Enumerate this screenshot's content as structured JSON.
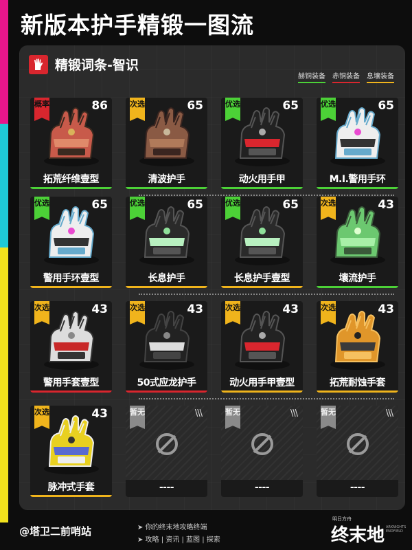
{
  "title": "新版本护手精锻一图流",
  "header": {
    "title": "精锻词条-智识",
    "icon": "glove-icon"
  },
  "legend": [
    {
      "label": "赫铜装备",
      "color": "#4cd137"
    },
    {
      "label": "赤铜装备",
      "color": "#d9262e"
    },
    {
      "label": "息壤装备",
      "color": "#f0b41c"
    }
  ],
  "colors": {
    "badge_red": "#d9262e",
    "badge_gold": "#f0b41c",
    "badge_green": "#4cd137",
    "badge_gray": "#8a8a8a"
  },
  "rows": [
    [
      {
        "name": "拓荒纤维壹型",
        "badge": "概率",
        "badge_type": "red",
        "level": "86",
        "tier": "green",
        "item": "red-glove-icon"
      },
      {
        "name": "清波护手",
        "badge": "次选",
        "badge_type": "gold",
        "level": "65",
        "tier": "green",
        "item": "brown-glove-icon"
      },
      {
        "name": "动火用手甲",
        "badge": "优选",
        "badge_type": "green",
        "level": "65",
        "tier": "green",
        "item": "red-armor-glove-icon"
      },
      {
        "name": "M.I.警用手环",
        "badge": "优选",
        "badge_type": "green",
        "level": "65",
        "tier": "green",
        "item": "white-glove-icon"
      }
    ],
    [
      {
        "name": "警用手环壹型",
        "badge": "优选",
        "badge_type": "green",
        "level": "65",
        "tier": "gold",
        "item": "white-glove-icon"
      },
      {
        "name": "长息护手",
        "badge": "优选",
        "badge_type": "green",
        "level": "65",
        "tier": "gold",
        "item": "green-glove-icon"
      },
      {
        "name": "长息护手壹型",
        "badge": "优选",
        "badge_type": "green",
        "level": "65",
        "tier": "gold",
        "item": "green-glove-icon"
      },
      {
        "name": "壤流护手",
        "badge": "次选",
        "badge_type": "gold",
        "level": "43",
        "tier": "green",
        "item": "crystal-glove-icon"
      }
    ],
    [
      {
        "name": "警用手套壹型",
        "badge": "次选",
        "badge_type": "gold",
        "level": "43",
        "tier": "red",
        "item": "red-white-glove-icon"
      },
      {
        "name": "50式应龙护手",
        "badge": "次选",
        "badge_type": "gold",
        "level": "43",
        "tier": "red",
        "item": "black-glove-icon"
      },
      {
        "name": "动火用手甲壹型",
        "badge": "次选",
        "badge_type": "gold",
        "level": "43",
        "tier": "gold",
        "item": "red-armor-glove-icon"
      },
      {
        "name": "拓荒耐蚀手套",
        "badge": "次选",
        "badge_type": "gold",
        "level": "43",
        "tier": "gold",
        "item": "orange-glove-icon"
      }
    ],
    [
      {
        "name": "脉冲式手套",
        "badge": "次选",
        "badge_type": "gold",
        "level": "43",
        "tier": "gold",
        "item": "yellow-glove-icon"
      },
      {
        "name": "----",
        "badge": "暂无",
        "badge_type": "gray",
        "level": "",
        "slashes": "\\\\\\",
        "tier": "none",
        "item": "empty-slot-icon"
      },
      {
        "name": "----",
        "badge": "暂无",
        "badge_type": "gray",
        "level": "",
        "slashes": "\\\\\\",
        "tier": "none",
        "item": "empty-slot-icon"
      },
      {
        "name": "----",
        "badge": "暂无",
        "badge_type": "gray",
        "level": "",
        "slashes": "\\\\\\",
        "tier": "none",
        "item": "empty-slot-icon"
      }
    ]
  ],
  "footer": {
    "handle": "@塔卫二前哨站",
    "line1": "➤ 你的终末地攻略终端",
    "line2": "➤ 攻略 | 资讯 | 蓝图 | 探索",
    "logo_small": "明日方舟",
    "logo_main": "终末地",
    "logo_en": "ARKNIGHTS ENDFIELD"
  }
}
